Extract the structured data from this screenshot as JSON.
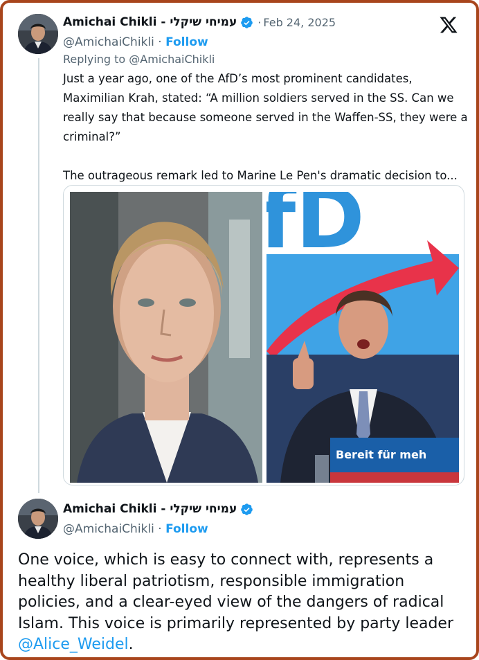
{
  "colors": {
    "frame": "#a8451c",
    "link": "#1d9bf0",
    "muted": "#536471"
  },
  "tweet": {
    "author_name": "Amichai Chikli - עמיחי שיקלי",
    "separator": "·",
    "date": "Feb 24, 2025",
    "handle": "@AmichaiChikli",
    "handle_separator": "·",
    "follow_label": "Follow",
    "replying_to": "Replying to @AmichaiChikli",
    "text_p1": "Just a year ago, one of the AfD’s most prominent candidates, Maximilian Krah, stated: “A million soldiers served in the SS. Can we really say that because someone served in the Waffen-SS, they were a criminal?”",
    "text_p2": "The outrageous remark led to Marine Le Pen's dramatic decision to...",
    "media": {
      "left_icon": "woman-portrait-photo",
      "right_icon": "speaker-at-afd-podium-photo",
      "backdrop_letters": "fD",
      "podium_text": "Bereit für meh"
    }
  },
  "reply": {
    "author_name": "Amichai Chikli - עמיחי שיקלי",
    "handle": "@AmichaiChikli",
    "handle_separator": "·",
    "follow_label": "Follow",
    "text_main": "One voice, which is easy to connect with, represents a healthy liberal patriotism, responsible immigration policies, and a clear-eyed view of the dangers of radical Islam. This voice is primarily represented by party leader ",
    "mention": "@Alice_Weidel",
    "text_end": "."
  },
  "icons": {
    "verified": "verified-badge-icon",
    "brand": "x-logo-icon"
  }
}
